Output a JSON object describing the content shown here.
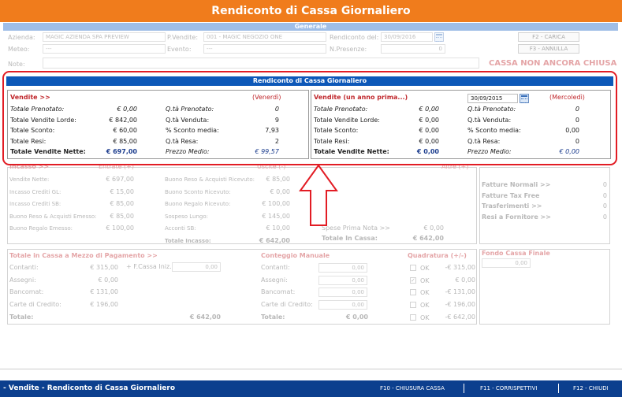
{
  "title": "Rendiconto di Cassa Giornaliero",
  "generale": {
    "header": "Generale",
    "azienda_label": "Azienda:",
    "azienda_value": "MAGIC AZIENDA SPA PREVIEW",
    "pvendite_label": "P.Vendite:",
    "pvendite_value": "001 - MAGIC NEGOZIO ONE",
    "rendiconto_label": "Rendiconto del:",
    "rendiconto_value": "30/09/2016",
    "carica_label": "F2 - CARICA",
    "meteo_label": "Meteo:",
    "meteo_value": "---",
    "evento_label": "Evento:",
    "evento_value": "---",
    "npresenze_label": "N.Presenze:",
    "npresenze_value": "0",
    "annulla_label": "F3 - ANNULLA",
    "note_label": "Note:",
    "status_text": "CASSA NON ANCORA CHIUSA"
  },
  "rendiconto": {
    "header": "Rendiconto di Cassa Giornaliero",
    "left": {
      "title": "Vendite >>",
      "day": "(Venerdì)",
      "rows": [
        {
          "label": "Totale Prenotato:",
          "value": "€ 0,00",
          "label2": "Q.tà Prenotato:",
          "value2": "0"
        },
        {
          "label": "Totale Vendite Lorde:",
          "value": "€ 842,00",
          "label2": "Q.tà Venduta:",
          "value2": "9"
        },
        {
          "label": "Totale Sconto:",
          "value": "€ 60,00",
          "label2": "% Sconto media:",
          "value2": "7,93"
        },
        {
          "label": "Totale Resi:",
          "value": "€ 85,00",
          "label2": "Q.tà Resa:",
          "value2": "2"
        },
        {
          "label": "Totale Vendite Nette:",
          "value": "€ 697,00",
          "label2": "Prezzo Medio:",
          "value2": "€ 99,57"
        }
      ]
    },
    "right": {
      "title": "Vendite (un anno prima...)",
      "date": "30/09/2015",
      "day": "(Mercoledì)",
      "rows": [
        {
          "label": "Totale Prenotato:",
          "value": "€ 0,00",
          "label2": "Q.tà Prenotato:",
          "value2": "0"
        },
        {
          "label": "Totale Vendite Lorde:",
          "value": "€ 0,00",
          "label2": "Q.tà Venduta:",
          "value2": "0"
        },
        {
          "label": "Totale Sconto:",
          "value": "€ 0,00",
          "label2": "% Sconto media:",
          "value2": "0,00"
        },
        {
          "label": "Totale Resi:",
          "value": "€ 0,00",
          "label2": "Q.tà Resa:",
          "value2": "0"
        },
        {
          "label": "Totale Vendite Nette:",
          "value": "€ 0,00",
          "label2": "Prezzo Medio:",
          "value2": "€ 0,00"
        }
      ]
    }
  },
  "incasso": {
    "header1": "Incasso >>",
    "header2": "Entrate (+)",
    "header3": "Uscite (-)",
    "header4": "Altre (+)",
    "col1": [
      {
        "label": "Vendite Nette:",
        "value": "€ 697,00"
      },
      {
        "label": "Incasso Crediti GL:",
        "value": "€ 15,00"
      },
      {
        "label": "Incasso Crediti SB:",
        "value": "€ 85,00"
      },
      {
        "label": "Buono Reso & Acquisti Emesso:",
        "value": "€ 85,00"
      },
      {
        "label": "Buono Regalo Emesso:",
        "value": "€ 100,00"
      }
    ],
    "col2": [
      {
        "label": "Buono Reso & Acquisti Ricevuto:",
        "value": "€ 85,00"
      },
      {
        "label": "Buono Sconto Ricevuto:",
        "value": "€ 0,00"
      },
      {
        "label": "Buono Regalo Ricevuto:",
        "value": "€ 100,00"
      },
      {
        "label": "Sospeso Lungo:",
        "value": "€ 145,00"
      },
      {
        "label": "Acconti SB:",
        "value": "€ 10,00"
      },
      {
        "label": "Totale Incasso:",
        "value": "€ 642,00"
      }
    ],
    "col3": [
      {
        "label": "Spese Prima Nota >>",
        "value": "€ 0,00"
      },
      {
        "label": "Totale In Cassa:",
        "value": "€ 642,00"
      }
    ],
    "side": [
      {
        "label": "Fatture Normali >>",
        "value": "0"
      },
      {
        "label": "Fatture Tax Free",
        "value": "0"
      },
      {
        "label": "Trasferimenti >>",
        "value": "0"
      },
      {
        "label": "Resi a Fornitore >>",
        "value": "0"
      }
    ]
  },
  "totale_cassa": {
    "header": "Totale in Cassa a Mezzo di Pagamento >>",
    "conteggio": "Conteggio Manuale",
    "quadratura": "Quadratura (+/-)",
    "fcassa_label": "+ F.Cassa Iniz.:",
    "fcassa_value": "0,00",
    "rows": [
      {
        "label": "Contanti:",
        "value": "€ 315,00",
        "label2": "Contanti:",
        "value2": "0,00",
        "ok": "OK",
        "diff": "-€ 315,00"
      },
      {
        "label": "Assegni:",
        "value": "€ 0,00",
        "label2": "Assegni:",
        "value2": "0,00",
        "ok": "OK",
        "diff": "€ 0,00"
      },
      {
        "label": "Bancomat:",
        "value": "€ 131,00",
        "label2": "Bancomat:",
        "value2": "0,00",
        "ok": "OK",
        "diff": "-€ 131,00"
      },
      {
        "label": "Carte di Credito:",
        "value": "€ 196,00",
        "label2": "Carte di Credito:",
        "value2": "0,00",
        "ok": "OK",
        "diff": "-€ 196,00"
      }
    ],
    "totale_label": "Totale:",
    "totale_value": "€ 642,00",
    "totale2_label": "Totale:",
    "totale2_value": "€ 0,00",
    "ok": "OK",
    "diff_tot": "-€ 642,00",
    "fondo_label": "Fondo Cassa Finale",
    "fondo_value": "0,00"
  },
  "bottom": {
    "title": "- Vendite - Rendiconto di Cassa Giornaliero",
    "f10": "F10 - CHIUSURA CASSA",
    "f11": "F11 - CORRISPETTIVI",
    "f12": "F12 - CHIUDI"
  }
}
